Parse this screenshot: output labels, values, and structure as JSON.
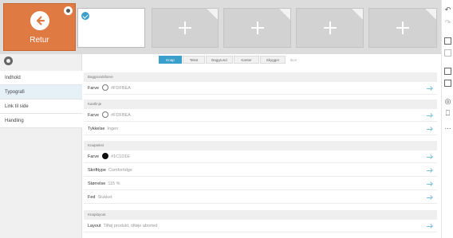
{
  "header": {
    "back_label": "Retur",
    "icons": {
      "back": "arrow-left-circle-icon",
      "settings": "gear-icon",
      "add": "plus-icon",
      "selected": "check-circle-icon"
    }
  },
  "sidebar": {
    "items": [
      {
        "label": "Indhold"
      },
      {
        "label": "Typografi"
      },
      {
        "label": "Link til side"
      },
      {
        "label": "Handling"
      }
    ]
  },
  "tabs": [
    "Knap",
    "Tekst",
    "Baggrund",
    "Kanter",
    "Skygger",
    "Ikon"
  ],
  "sections": {
    "background": {
      "title": "Baggrundsfarve",
      "color_label": "Farve",
      "color_value": "#FDFBEA"
    },
    "border": {
      "title": "Kantlinje",
      "color_label": "Farve",
      "color_value": "#FDFBEA",
      "thickness_label": "Tykkelse",
      "thickness_value": "Ingen"
    },
    "text": {
      "title": "Knaptekst",
      "color_label": "Farve",
      "color_value": "#1C1D1E",
      "font_label": "Skrifttype",
      "font_value": "Comfortidge",
      "size_label": "Størrelse",
      "size_value": "115 %",
      "bold_label": "Fed",
      "bold_value": "Slukket"
    },
    "layout": {
      "title": "Knaplayout",
      "layout_label": "Layout",
      "layout_value": "Tilføj produkt, tilføje aborted"
    }
  },
  "colors": {
    "accent": "#3a9fca",
    "retur": "#e07a43",
    "swatch_dark": "#111111"
  }
}
